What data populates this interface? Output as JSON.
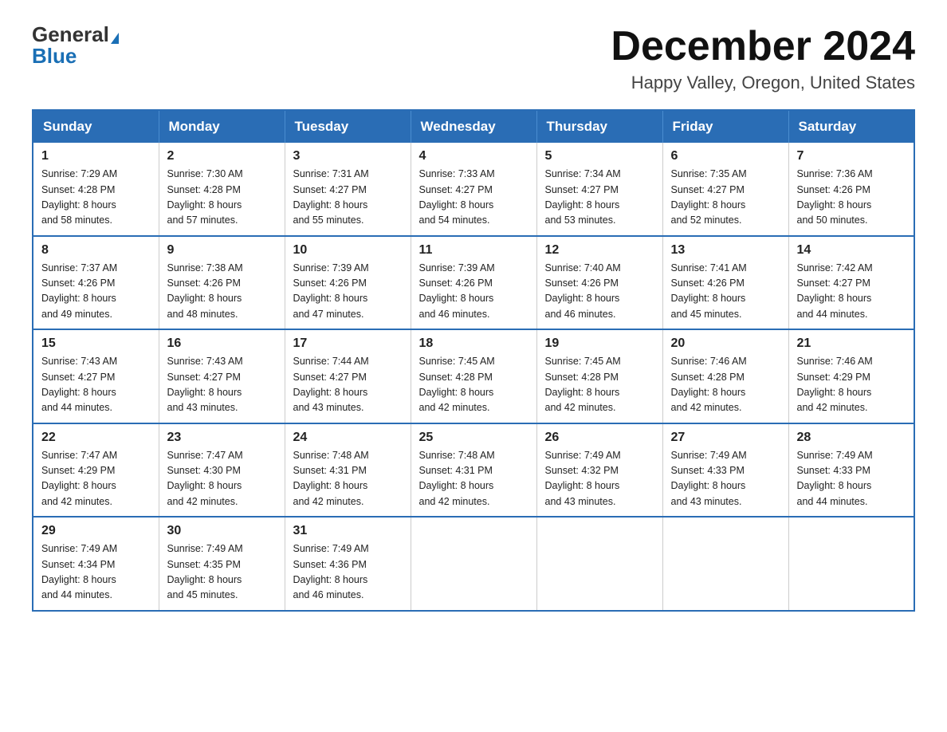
{
  "logo": {
    "general": "General",
    "blue": "Blue"
  },
  "title": "December 2024",
  "location": "Happy Valley, Oregon, United States",
  "days_of_week": [
    "Sunday",
    "Monday",
    "Tuesday",
    "Wednesday",
    "Thursday",
    "Friday",
    "Saturday"
  ],
  "weeks": [
    [
      {
        "day": "1",
        "sunrise": "7:29 AM",
        "sunset": "4:28 PM",
        "daylight": "8 hours and 58 minutes."
      },
      {
        "day": "2",
        "sunrise": "7:30 AM",
        "sunset": "4:28 PM",
        "daylight": "8 hours and 57 minutes."
      },
      {
        "day": "3",
        "sunrise": "7:31 AM",
        "sunset": "4:27 PM",
        "daylight": "8 hours and 55 minutes."
      },
      {
        "day": "4",
        "sunrise": "7:33 AM",
        "sunset": "4:27 PM",
        "daylight": "8 hours and 54 minutes."
      },
      {
        "day": "5",
        "sunrise": "7:34 AM",
        "sunset": "4:27 PM",
        "daylight": "8 hours and 53 minutes."
      },
      {
        "day": "6",
        "sunrise": "7:35 AM",
        "sunset": "4:27 PM",
        "daylight": "8 hours and 52 minutes."
      },
      {
        "day": "7",
        "sunrise": "7:36 AM",
        "sunset": "4:26 PM",
        "daylight": "8 hours and 50 minutes."
      }
    ],
    [
      {
        "day": "8",
        "sunrise": "7:37 AM",
        "sunset": "4:26 PM",
        "daylight": "8 hours and 49 minutes."
      },
      {
        "day": "9",
        "sunrise": "7:38 AM",
        "sunset": "4:26 PM",
        "daylight": "8 hours and 48 minutes."
      },
      {
        "day": "10",
        "sunrise": "7:39 AM",
        "sunset": "4:26 PM",
        "daylight": "8 hours and 47 minutes."
      },
      {
        "day": "11",
        "sunrise": "7:39 AM",
        "sunset": "4:26 PM",
        "daylight": "8 hours and 46 minutes."
      },
      {
        "day": "12",
        "sunrise": "7:40 AM",
        "sunset": "4:26 PM",
        "daylight": "8 hours and 46 minutes."
      },
      {
        "day": "13",
        "sunrise": "7:41 AM",
        "sunset": "4:26 PM",
        "daylight": "8 hours and 45 minutes."
      },
      {
        "day": "14",
        "sunrise": "7:42 AM",
        "sunset": "4:27 PM",
        "daylight": "8 hours and 44 minutes."
      }
    ],
    [
      {
        "day": "15",
        "sunrise": "7:43 AM",
        "sunset": "4:27 PM",
        "daylight": "8 hours and 44 minutes."
      },
      {
        "day": "16",
        "sunrise": "7:43 AM",
        "sunset": "4:27 PM",
        "daylight": "8 hours and 43 minutes."
      },
      {
        "day": "17",
        "sunrise": "7:44 AM",
        "sunset": "4:27 PM",
        "daylight": "8 hours and 43 minutes."
      },
      {
        "day": "18",
        "sunrise": "7:45 AM",
        "sunset": "4:28 PM",
        "daylight": "8 hours and 42 minutes."
      },
      {
        "day": "19",
        "sunrise": "7:45 AM",
        "sunset": "4:28 PM",
        "daylight": "8 hours and 42 minutes."
      },
      {
        "day": "20",
        "sunrise": "7:46 AM",
        "sunset": "4:28 PM",
        "daylight": "8 hours and 42 minutes."
      },
      {
        "day": "21",
        "sunrise": "7:46 AM",
        "sunset": "4:29 PM",
        "daylight": "8 hours and 42 minutes."
      }
    ],
    [
      {
        "day": "22",
        "sunrise": "7:47 AM",
        "sunset": "4:29 PM",
        "daylight": "8 hours and 42 minutes."
      },
      {
        "day": "23",
        "sunrise": "7:47 AM",
        "sunset": "4:30 PM",
        "daylight": "8 hours and 42 minutes."
      },
      {
        "day": "24",
        "sunrise": "7:48 AM",
        "sunset": "4:31 PM",
        "daylight": "8 hours and 42 minutes."
      },
      {
        "day": "25",
        "sunrise": "7:48 AM",
        "sunset": "4:31 PM",
        "daylight": "8 hours and 42 minutes."
      },
      {
        "day": "26",
        "sunrise": "7:49 AM",
        "sunset": "4:32 PM",
        "daylight": "8 hours and 43 minutes."
      },
      {
        "day": "27",
        "sunrise": "7:49 AM",
        "sunset": "4:33 PM",
        "daylight": "8 hours and 43 minutes."
      },
      {
        "day": "28",
        "sunrise": "7:49 AM",
        "sunset": "4:33 PM",
        "daylight": "8 hours and 44 minutes."
      }
    ],
    [
      {
        "day": "29",
        "sunrise": "7:49 AM",
        "sunset": "4:34 PM",
        "daylight": "8 hours and 44 minutes."
      },
      {
        "day": "30",
        "sunrise": "7:49 AM",
        "sunset": "4:35 PM",
        "daylight": "8 hours and 45 minutes."
      },
      {
        "day": "31",
        "sunrise": "7:49 AM",
        "sunset": "4:36 PM",
        "daylight": "8 hours and 46 minutes."
      },
      null,
      null,
      null,
      null
    ]
  ],
  "labels": {
    "sunrise": "Sunrise:",
    "sunset": "Sunset:",
    "daylight": "Daylight:"
  }
}
